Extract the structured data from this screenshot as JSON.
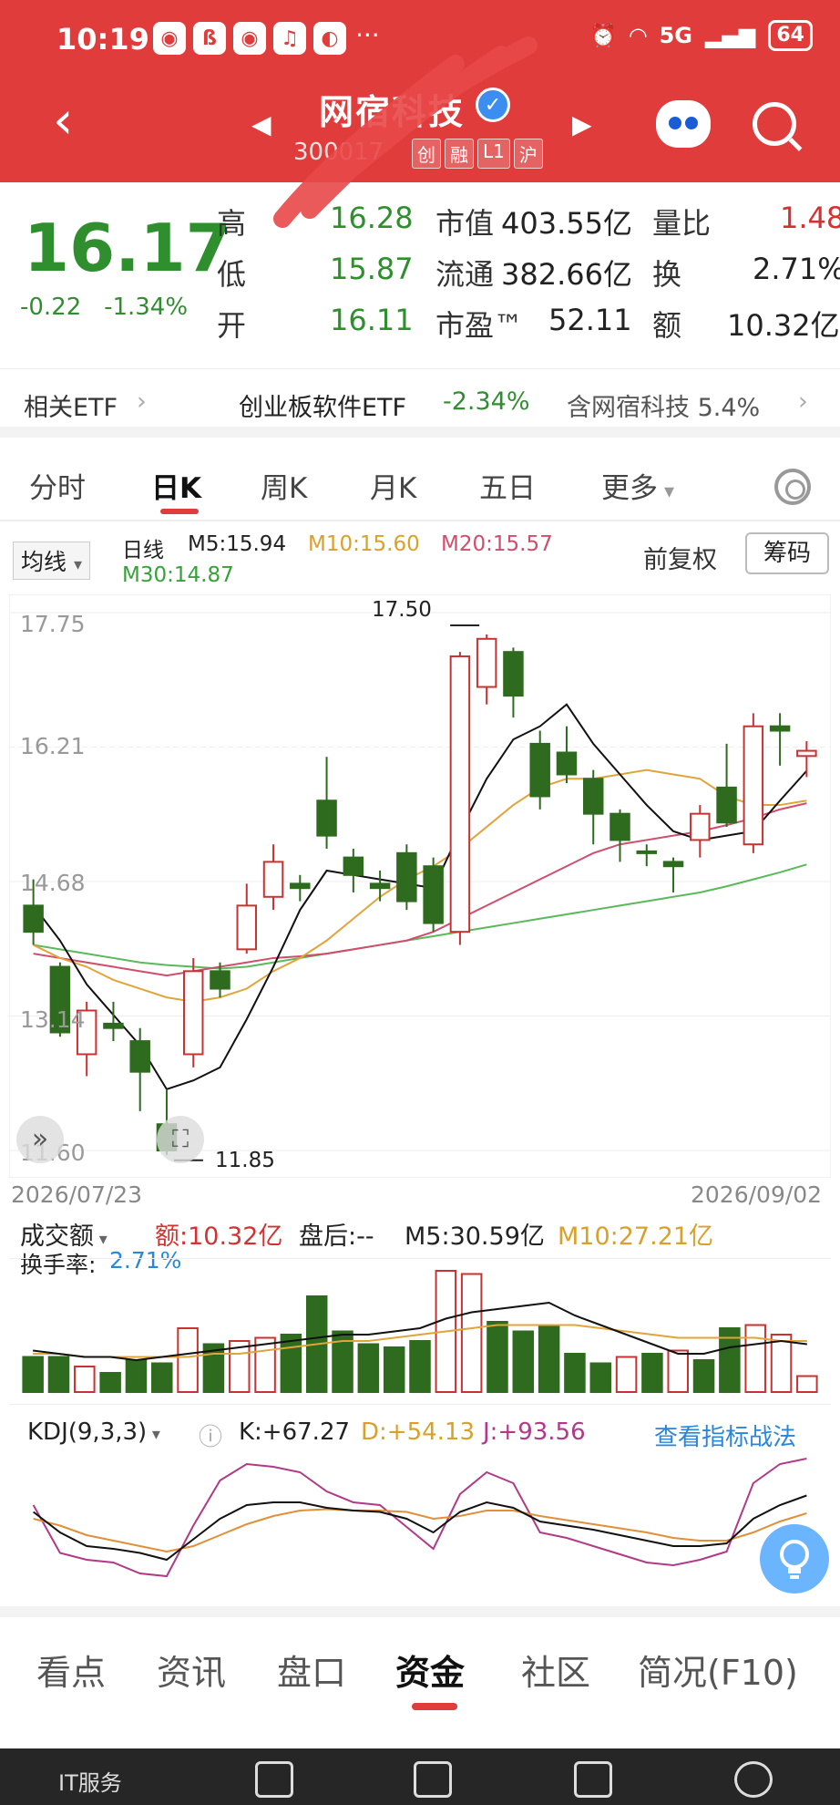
{
  "status": {
    "time": "10:19",
    "icons": [
      "weibo-icon",
      "app-icon",
      "weibo-icon",
      "music-icon",
      "browser-icon"
    ],
    "dots": "···",
    "network": "5G",
    "battery": "64"
  },
  "header": {
    "stock_name": "网宿科技",
    "stock_code": "300017",
    "tags": [
      "创",
      "融",
      "L1",
      "沪"
    ]
  },
  "quote": {
    "price": "16.17",
    "change": "-0.22",
    "change_pct": "-1.34%",
    "high_label": "高",
    "high": "16.28",
    "low_label": "低",
    "low": "15.87",
    "open_label": "开",
    "open": "16.11",
    "mktcap_label": "市值",
    "mktcap": "403.55亿",
    "float_label": "流通",
    "float": "382.66亿",
    "pe_label": "市盈™",
    "pe": "52.11",
    "volratio_label": "量比",
    "volratio": "1.48",
    "turnover_label": "换",
    "turnover": "2.71%",
    "amount_label": "额",
    "amount": "10.32亿"
  },
  "etf": {
    "label": "相关ETF",
    "name": "创业板软件ETF",
    "change": "-2.34%",
    "holding": "含网宿科技 5.4%"
  },
  "tabs": [
    "分时",
    "日K",
    "周K",
    "月K",
    "五日",
    "更多"
  ],
  "ma": {
    "select": "均线",
    "period": "日线",
    "m5": "M5:15.94",
    "m10": "M10:15.60",
    "m20": "M20:15.57",
    "m30": "M30:14.87",
    "adjust": "前复权",
    "chips": "筹码"
  },
  "chart_data": {
    "type": "candlestick",
    "y_ticks": [
      "17.75",
      "16.21",
      "14.68",
      "13.14",
      "11.60"
    ],
    "ylim": [
      11.6,
      17.75
    ],
    "start_date": "2026/07/23",
    "end_date": "2026/09/02",
    "max_label": "17.50",
    "min_label": "11.85",
    "candles": [
      {
        "o": 14.4,
        "c": 14.1,
        "h": 14.7,
        "l": 13.95
      },
      {
        "o": 13.7,
        "c": 12.95,
        "h": 13.75,
        "l": 12.9
      },
      {
        "o": 12.7,
        "c": 13.2,
        "h": 13.3,
        "l": 12.45
      },
      {
        "o": 13.05,
        "c": 13.0,
        "h": 13.3,
        "l": 12.85
      },
      {
        "o": 12.85,
        "c": 12.5,
        "h": 13.0,
        "l": 12.05
      },
      {
        "o": 11.9,
        "c": 11.6,
        "h": 12.3,
        "l": 11.55
      },
      {
        "o": 12.7,
        "c": 13.65,
        "h": 13.8,
        "l": 12.55
      },
      {
        "o": 13.65,
        "c": 13.45,
        "h": 13.75,
        "l": 13.35
      },
      {
        "o": 13.9,
        "c": 14.4,
        "h": 14.65,
        "l": 13.85
      },
      {
        "o": 14.5,
        "c": 14.9,
        "h": 15.1,
        "l": 14.35
      },
      {
        "o": 14.65,
        "c": 14.6,
        "h": 14.75,
        "l": 14.45
      },
      {
        "o": 15.6,
        "c": 15.2,
        "h": 16.1,
        "l": 15.05
      },
      {
        "o": 14.95,
        "c": 14.75,
        "h": 15.05,
        "l": 14.55
      },
      {
        "o": 14.65,
        "c": 14.6,
        "h": 14.8,
        "l": 14.45
      },
      {
        "o": 15.0,
        "c": 14.45,
        "h": 15.1,
        "l": 14.35
      },
      {
        "o": 14.85,
        "c": 14.2,
        "h": 14.95,
        "l": 14.1
      },
      {
        "o": 14.1,
        "c": 17.25,
        "h": 17.3,
        "l": 13.95
      },
      {
        "o": 16.9,
        "c": 17.45,
        "h": 17.5,
        "l": 16.7
      },
      {
        "o": 17.3,
        "c": 16.8,
        "h": 17.35,
        "l": 16.55
      },
      {
        "o": 16.25,
        "c": 15.65,
        "h": 16.4,
        "l": 15.5
      },
      {
        "o": 16.15,
        "c": 15.9,
        "h": 16.45,
        "l": 15.8
      },
      {
        "o": 15.85,
        "c": 15.45,
        "h": 15.95,
        "l": 15.1
      },
      {
        "o": 15.45,
        "c": 15.15,
        "h": 15.5,
        "l": 14.9
      },
      {
        "o": 15.02,
        "c": 15.0,
        "h": 15.1,
        "l": 14.85
      },
      {
        "o": 14.9,
        "c": 14.85,
        "h": 14.95,
        "l": 14.55
      },
      {
        "o": 15.15,
        "c": 15.45,
        "h": 15.55,
        "l": 14.95
      },
      {
        "o": 15.75,
        "c": 15.35,
        "h": 16.25,
        "l": 15.3
      },
      {
        "o": 15.1,
        "c": 16.45,
        "h": 16.6,
        "l": 15.0
      },
      {
        "o": 16.45,
        "c": 16.4,
        "h": 16.6,
        "l": 16.0
      },
      {
        "o": 16.11,
        "c": 16.17,
        "h": 16.28,
        "l": 15.87
      }
    ],
    "m5": [
      14.4,
      14.0,
      13.5,
      13.15,
      12.8,
      12.3,
      12.4,
      12.55,
      13.1,
      13.7,
      14.35,
      14.8,
      14.75,
      14.7,
      14.65,
      14.6,
      15.25,
      15.85,
      16.3,
      16.45,
      16.7,
      16.25,
      15.9,
      15.55,
      15.25,
      15.15,
      15.2,
      15.25,
      15.6,
      15.94
    ],
    "m10": [
      13.95,
      13.8,
      13.7,
      13.55,
      13.45,
      13.35,
      13.3,
      13.35,
      13.45,
      13.65,
      13.8,
      14.0,
      14.25,
      14.5,
      14.7,
      14.85,
      15.05,
      15.3,
      15.55,
      15.75,
      15.85,
      15.85,
      15.9,
      15.95,
      15.9,
      15.85,
      15.65,
      15.55,
      15.55,
      15.6
    ],
    "m20": [
      13.85,
      13.8,
      13.75,
      13.7,
      13.65,
      13.6,
      13.65,
      13.7,
      13.75,
      13.8,
      13.82,
      13.85,
      13.9,
      13.95,
      14.0,
      14.1,
      14.25,
      14.4,
      14.55,
      14.7,
      14.85,
      15.0,
      15.1,
      15.15,
      15.2,
      15.25,
      15.32,
      15.4,
      15.5,
      15.57
    ],
    "m30": [
      13.95,
      13.9,
      13.85,
      13.8,
      13.75,
      13.72,
      13.7,
      13.68,
      13.7,
      13.75,
      13.8,
      13.85,
      13.9,
      13.95,
      14.0,
      14.05,
      14.1,
      14.15,
      14.2,
      14.25,
      14.3,
      14.35,
      14.4,
      14.45,
      14.5,
      14.55,
      14.62,
      14.7,
      14.78,
      14.87
    ]
  },
  "volume": {
    "select": "成交额",
    "amount": "额:10.32亿",
    "after": "盘后:--",
    "m5": "M5:30.59亿",
    "m10": "M10:27.21亿",
    "turnover_label": "换手率:",
    "turnover": "2.71%",
    "bars": [
      22,
      22,
      16,
      12,
      20,
      18,
      40,
      30,
      32,
      34,
      36,
      60,
      38,
      30,
      28,
      32,
      76,
      74,
      44,
      38,
      42,
      24,
      18,
      22,
      24,
      26,
      20,
      40,
      42,
      36,
      10
    ],
    "up": [
      false,
      false,
      true,
      false,
      false,
      false,
      true,
      false,
      true,
      true,
      false,
      false,
      false,
      false,
      false,
      false,
      true,
      true,
      false,
      false,
      false,
      false,
      false,
      true,
      false,
      true,
      false,
      false,
      true,
      true,
      true
    ],
    "m5_line": [
      26,
      24,
      22,
      22,
      20,
      22,
      24,
      26,
      28,
      30,
      32,
      34,
      36,
      36,
      38,
      40,
      46,
      50,
      52,
      54,
      56,
      48,
      42,
      36,
      30,
      24,
      24,
      28,
      30,
      32,
      30
    ],
    "m10_line": [
      24,
      24,
      22,
      22,
      22,
      22,
      22,
      24,
      24,
      26,
      28,
      30,
      32,
      32,
      34,
      36,
      38,
      40,
      42,
      42,
      42,
      42,
      40,
      38,
      36,
      34,
      34,
      34,
      34,
      32,
      32
    ]
  },
  "kdj": {
    "label": "KDJ(9,3,3)",
    "k": "K:+67.27",
    "d": "D:+54.13",
    "j": "J:+93.56",
    "link": "查看指标战法",
    "k_line": [
      55,
      40,
      30,
      28,
      25,
      20,
      35,
      50,
      60,
      62,
      62,
      58,
      56,
      55,
      50,
      40,
      55,
      62,
      58,
      48,
      45,
      42,
      38,
      34,
      30,
      30,
      32,
      50,
      60,
      67
    ],
    "d_line": [
      50,
      45,
      38,
      34,
      30,
      26,
      30,
      38,
      46,
      52,
      56,
      57,
      56,
      56,
      55,
      50,
      52,
      56,
      56,
      52,
      49,
      46,
      43,
      40,
      36,
      34,
      34,
      40,
      48,
      54
    ],
    "j_line": [
      60,
      25,
      20,
      18,
      10,
      8,
      45,
      78,
      90,
      88,
      84,
      70,
      62,
      60,
      44,
      28,
      68,
      84,
      76,
      40,
      36,
      30,
      24,
      18,
      16,
      20,
      26,
      76,
      90,
      94
    ]
  },
  "bottom_tabs": [
    "看点",
    "资讯",
    "盘口",
    "资金",
    "社区",
    "简况(F10)"
  ],
  "navbar": {
    "left": "IT服务"
  }
}
